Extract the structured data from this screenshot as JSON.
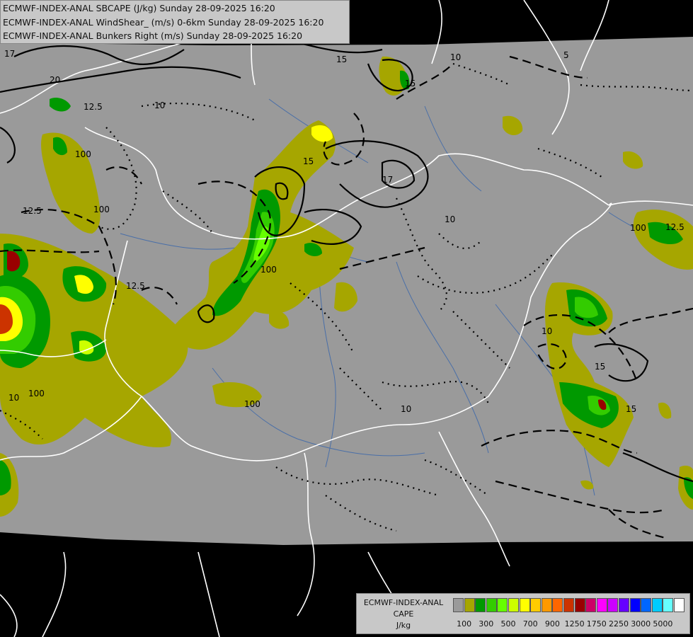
{
  "header": {
    "lines": [
      "ECMWF-INDEX-ANAL SBCAPE (J/kg) Sunday 28-09-2025 16:20",
      "ECMWF-INDEX-ANAL WindShear_ (m/s) 0-6km Sunday 28-09-2025 16:20",
      "ECMWF-INDEX-ANAL Bunkers Right (m/s) Sunday 28-09-2025 16:20"
    ]
  },
  "legend": {
    "title_line1": "ECMWF-INDEX-ANAL",
    "title_line2": "CAPE",
    "title_line3": "J/kg",
    "colors": [
      "#9a9a9a",
      "#a6a600",
      "#009900",
      "#33cc00",
      "#66ff00",
      "#ccff00",
      "#ffff00",
      "#ffcc00",
      "#ff9900",
      "#ff6600",
      "#cc3300",
      "#990000",
      "#cc0066",
      "#ff00ff",
      "#cc00ff",
      "#6600ff",
      "#0000ff",
      "#0066ff",
      "#00ccff",
      "#66ffff",
      "#ffffff"
    ],
    "tick_labels": [
      "100",
      "300",
      "500",
      "700",
      "900",
      "1250",
      "1750",
      "2250",
      "3000",
      "5000"
    ]
  },
  "contour_labels": [
    "17",
    "20",
    "15",
    "12.5",
    "10",
    "100",
    "12.5",
    "100",
    "15",
    "17",
    "10",
    "12.5",
    "100",
    "10",
    "5",
    "15",
    "10",
    "100",
    "10",
    "100",
    "15",
    "12.5",
    "100",
    "15",
    "10"
  ],
  "map_colors": {
    "land_gray": "#9a9a9a",
    "outside": "#000000",
    "border": "#ffffff",
    "river": "#4a6fa8",
    "cape_100": "#a6a600",
    "cape_300": "#009900",
    "cape_500": "#33cc00",
    "cape_700": "#66ff00",
    "cape_900": "#ffff00",
    "cape_high": "#990000"
  }
}
